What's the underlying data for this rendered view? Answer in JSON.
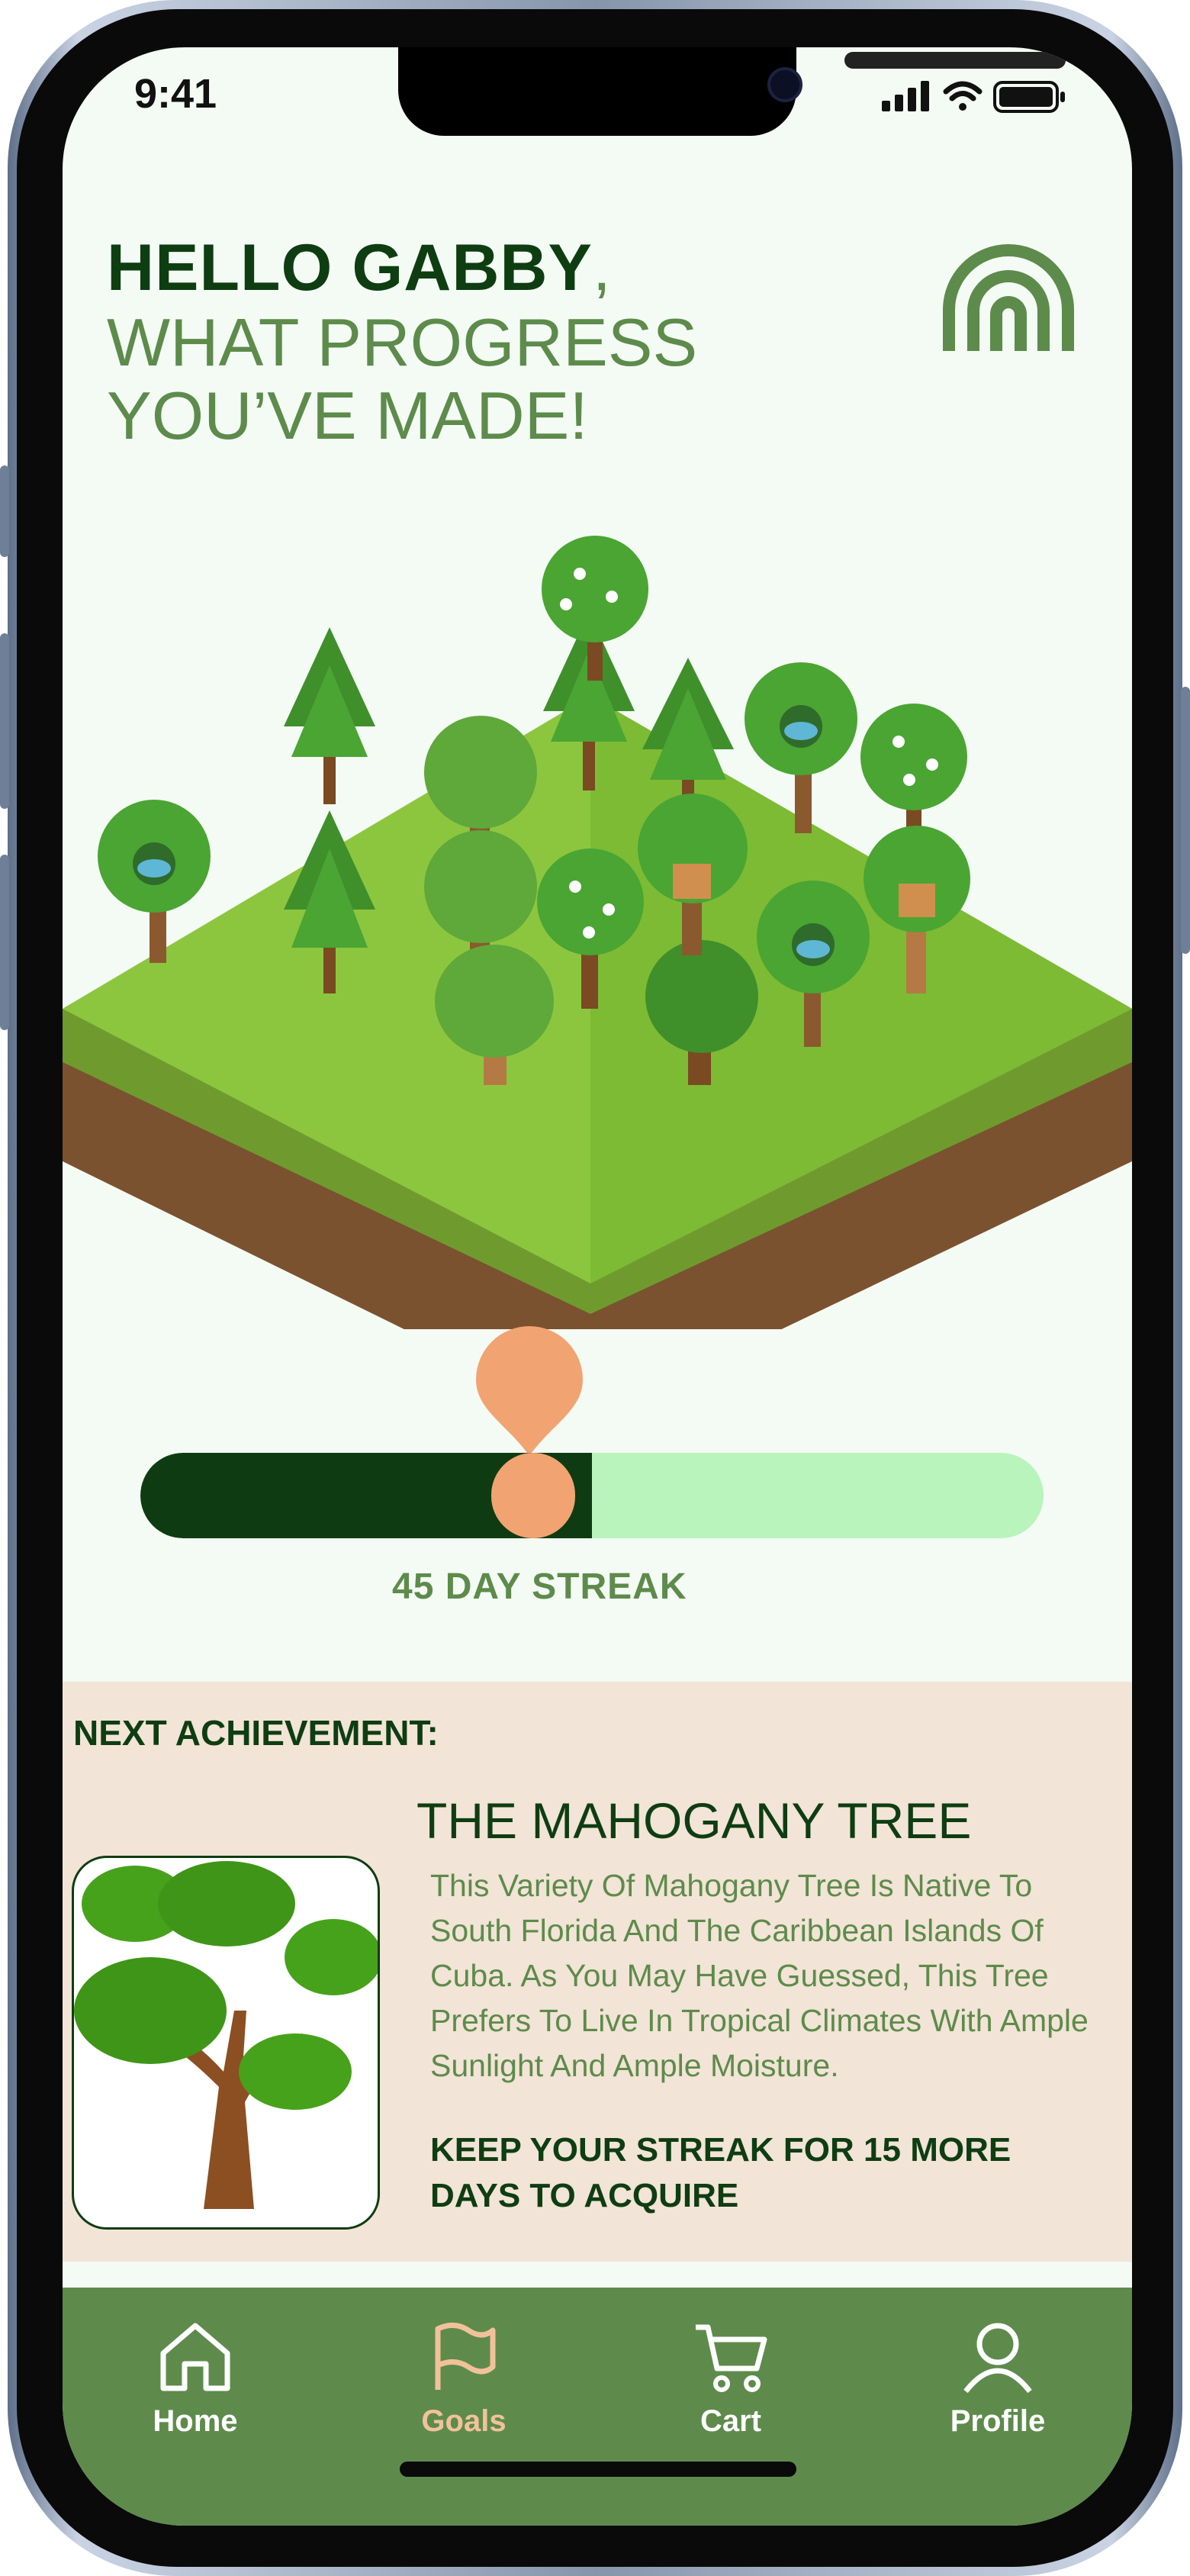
{
  "status_bar": {
    "time": "9:41"
  },
  "header": {
    "greeting_name": "HELLO GABBY",
    "greeting_punct": ",",
    "line1": "WHAT PROGRESS",
    "line2": "YOU’VE MADE!",
    "logo": "rainbow-logo"
  },
  "progress": {
    "streak_label": "45 DAY STREAK",
    "fraction": 0.5
  },
  "achievement": {
    "heading": "NEXT ACHIEVEMENT:",
    "title": "THE MAHOGANY TREE",
    "description": "This Variety Of Mahogany Tree Is Native To South Florida And The Caribbean Islands Of Cuba. As You May Have Guessed, This Tree Prefers To Live In Tropical Climates With Ample Sunlight And Ample Moisture.",
    "cta": "KEEP YOUR STREAK FOR 15 MORE DAYS TO ACQUIRE"
  },
  "nav": {
    "items": [
      {
        "label": "Home",
        "icon": "home-icon",
        "active": false
      },
      {
        "label": "Goals",
        "icon": "flag-icon",
        "active": true
      },
      {
        "label": "Cart",
        "icon": "cart-icon",
        "active": false
      },
      {
        "label": "Profile",
        "icon": "profile-icon",
        "active": false
      }
    ]
  },
  "colors": {
    "dark_green": "#0e3d12",
    "mid_green": "#5d8b4b",
    "light_green": "#b9f4bd",
    "accent_orange": "#f1a472",
    "beige": "#f2e4d6",
    "background": "#f4faf4"
  }
}
